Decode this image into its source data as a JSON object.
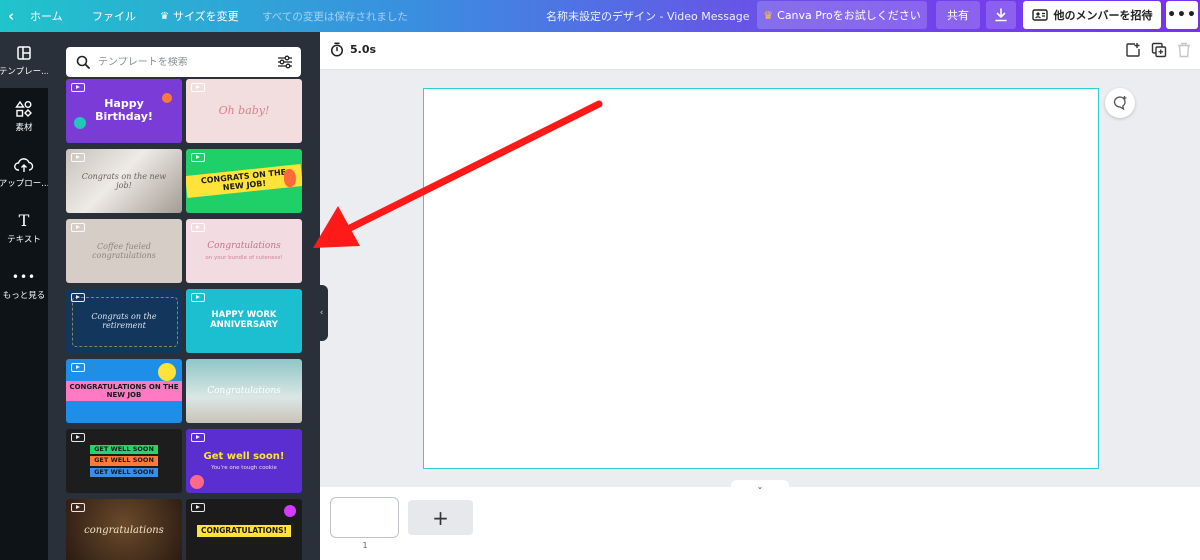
{
  "topbar": {
    "back_glyph": "‹",
    "home_label": "ホーム",
    "file_label": "ファイル",
    "resize_label": "サイズを変更",
    "saved_status": "すべての変更は保存されました",
    "doc_title": "名称未設定のデザイン - Video Message",
    "pro_label": "Canva Proをお試しください",
    "share_label": "共有",
    "invite_label": "他のメンバーを招待",
    "more_label": "•••"
  },
  "rail": {
    "items": [
      {
        "label": "テンプレー...",
        "icon": "template-icon"
      },
      {
        "label": "素材",
        "icon": "elements-icon"
      },
      {
        "label": "アップロー...",
        "icon": "upload-icon"
      },
      {
        "label": "テキスト",
        "icon": "text-icon"
      },
      {
        "label": "もっと見る",
        "icon": "more-icon"
      }
    ]
  },
  "panel": {
    "search_placeholder": "テンプレートを検索",
    "templates": [
      {
        "text": "Happy Birthday!"
      },
      {
        "text": "Oh baby!"
      },
      {
        "text": "Congrats on the new job!"
      },
      {
        "text": "CONGRATS ON THE NEW JOB!"
      },
      {
        "text": "Coffee fueled congratulations"
      },
      {
        "text": "Congratulations",
        "sub": "on your bundle of cuteness!"
      },
      {
        "text": "Congrats on the retirement"
      },
      {
        "text": "HAPPY WORK ANNIVERSARY"
      },
      {
        "text": "CONGRATULATIONS ON THE NEW JOB"
      },
      {
        "text": "Congratulations"
      },
      {
        "lines": [
          "GET WELL SOON",
          "GET WELL SOON",
          "GET WELL SOON"
        ]
      },
      {
        "text": "Get well soon!",
        "sub": "You're one tough cookie"
      },
      {
        "text": "congratulations"
      },
      {
        "text": "CONGRATULATIONS!"
      }
    ]
  },
  "editor": {
    "duration": "5.0s",
    "page_number": "1",
    "add_page_label": "+",
    "collapse_glyph": "‹",
    "timeline_toggle_glyph": "⌄"
  },
  "colors": {
    "topbar_gradient_start": "#20c4cb",
    "topbar_gradient_end": "#7a2ff0",
    "rail_bg": "#0e1318",
    "panel_bg": "#293039",
    "canvas_border": "#2ecfd6",
    "annotation_arrow": "#ff1a1a"
  }
}
